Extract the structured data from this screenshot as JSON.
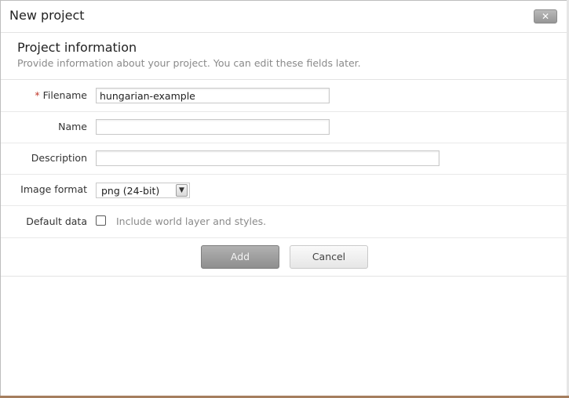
{
  "dialog": {
    "title": "New project",
    "close_label": "✕"
  },
  "section": {
    "title": "Project information",
    "description": "Provide information about your project. You can edit these fields later."
  },
  "fields": {
    "filename": {
      "required_mark": "*",
      "label": "Filename",
      "value": "hungarian-example"
    },
    "name": {
      "label": "Name",
      "value": ""
    },
    "description": {
      "label": "Description",
      "value": ""
    },
    "image_format": {
      "label": "Image format",
      "selected": "png (24-bit)"
    },
    "default_data": {
      "label": "Default data",
      "checked": false,
      "checkbox_label": "Include world layer and styles."
    }
  },
  "actions": {
    "add_label": "Add",
    "cancel_label": "Cancel"
  },
  "icons": {
    "close": "close-icon",
    "dropdown": "chevron-down-icon"
  },
  "colors": {
    "required": "#c0392b",
    "bottom_accent": "#a57e5e"
  }
}
